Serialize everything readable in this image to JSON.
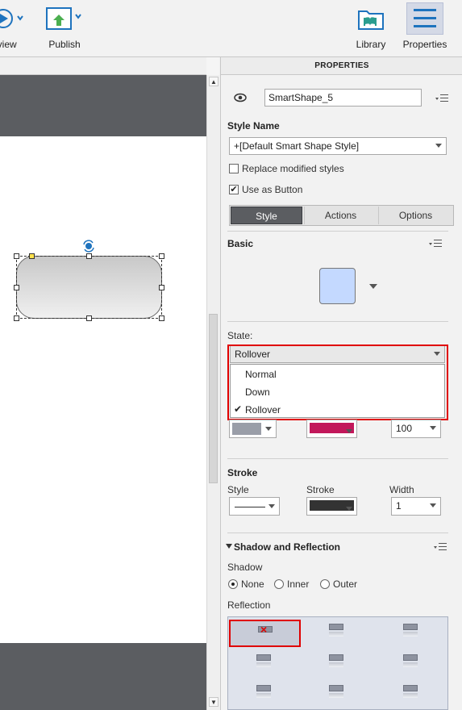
{
  "toolbar": {
    "preview_label": "eview",
    "publish_label": "Publish",
    "library_label": "Library",
    "properties_label": "Properties"
  },
  "panel": {
    "header": "PROPERTIES",
    "object_name": "SmartShape_5",
    "style_name_label": "Style Name",
    "style_name_value": "+[Default Smart Shape Style]",
    "replace_modified_label": "Replace modified styles",
    "replace_modified_checked": false,
    "use_as_button_label": "Use as Button",
    "use_as_button_checked": true,
    "tabs": [
      {
        "label": "Style",
        "active": true
      },
      {
        "label": "Actions",
        "active": false
      },
      {
        "label": "Options",
        "active": false
      }
    ],
    "basic": {
      "title": "Basic",
      "shape_fill_color": "#c4d9ff"
    },
    "state": {
      "label": "State:",
      "selected": "Rollover",
      "options": [
        {
          "label": "Normal",
          "checked": false
        },
        {
          "label": "Down",
          "checked": false
        },
        {
          "label": "Rollover",
          "checked": true
        }
      ]
    },
    "fill": {
      "fill_color": "#9a9ea8",
      "second_color": "#c2185b",
      "opacity_value": "100"
    },
    "stroke": {
      "title": "Stroke",
      "style_label": "Style",
      "stroke_label": "Stroke",
      "width_label": "Width",
      "stroke_color": "#333333",
      "width_value": "1"
    },
    "shadow": {
      "title": "Shadow and Reflection",
      "shadow_label": "Shadow",
      "options": [
        {
          "label": "None",
          "selected": true
        },
        {
          "label": "Inner",
          "selected": false
        },
        {
          "label": "Outer",
          "selected": false
        }
      ],
      "reflection_label": "Reflection"
    }
  },
  "colors": {
    "highlight": "#e00000",
    "stage_dark": "#5b5d61",
    "active_tab": "#5b5d61"
  }
}
